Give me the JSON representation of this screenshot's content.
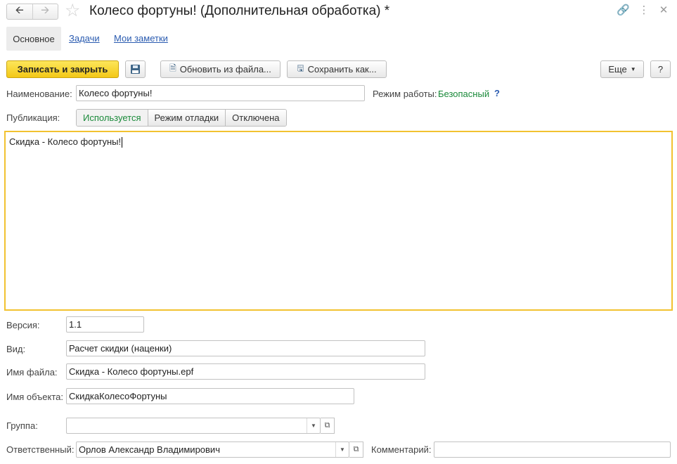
{
  "header": {
    "title": "Колесо фортуны! (Дополнительная обработка) *",
    "icons": {
      "back": "arrow-left-icon",
      "forward": "arrow-right-icon",
      "favorite": "star-icon",
      "link": "link-icon",
      "more": "kebab-menu-icon",
      "close": "close-icon"
    }
  },
  "tabs": [
    {
      "label": "Основное",
      "active": true
    },
    {
      "label": "Задачи",
      "active": false
    },
    {
      "label": "Мои заметки",
      "active": false
    }
  ],
  "toolbar": {
    "save_close": "Записать и закрыть",
    "save_icon": "floppy-disk-icon",
    "update_from_file": "Обновить из файла...",
    "save_as": "Сохранить как...",
    "more": "Еще",
    "help": "?"
  },
  "form": {
    "name_label": "Наименование:",
    "name_value": "Колесо фортуны!",
    "mode_label": "Режим работы:",
    "mode_value": "Безопасный",
    "mode_help": "?",
    "publication_label": "Публикация:",
    "publication_options": [
      "Используется",
      "Режим отладки",
      "Отключена"
    ],
    "publication_selected": "Используется",
    "description": "Скидка - Колесо фортуны!",
    "version_label": "Версия:",
    "version_value": "1.1",
    "kind_label": "Вид:",
    "kind_value": "Расчет скидки (наценки)",
    "filename_label": "Имя файла:",
    "filename_value": "Скидка - Колесо фортуны.epf",
    "object_label": "Имя объекта:",
    "object_value": "СкидкаКолесоФортуны",
    "group_label": "Группа:",
    "group_value": "",
    "responsible_label": "Ответственный:",
    "responsible_value": "Орлов Александр Владимирович",
    "comment_label": "Комментарий:",
    "comment_value": ""
  },
  "colors": {
    "accent_yellow": "#f5cd1f",
    "safe_green": "#1a8a3a",
    "link_blue": "#2a5bb0",
    "editor_border": "#f2c230"
  }
}
